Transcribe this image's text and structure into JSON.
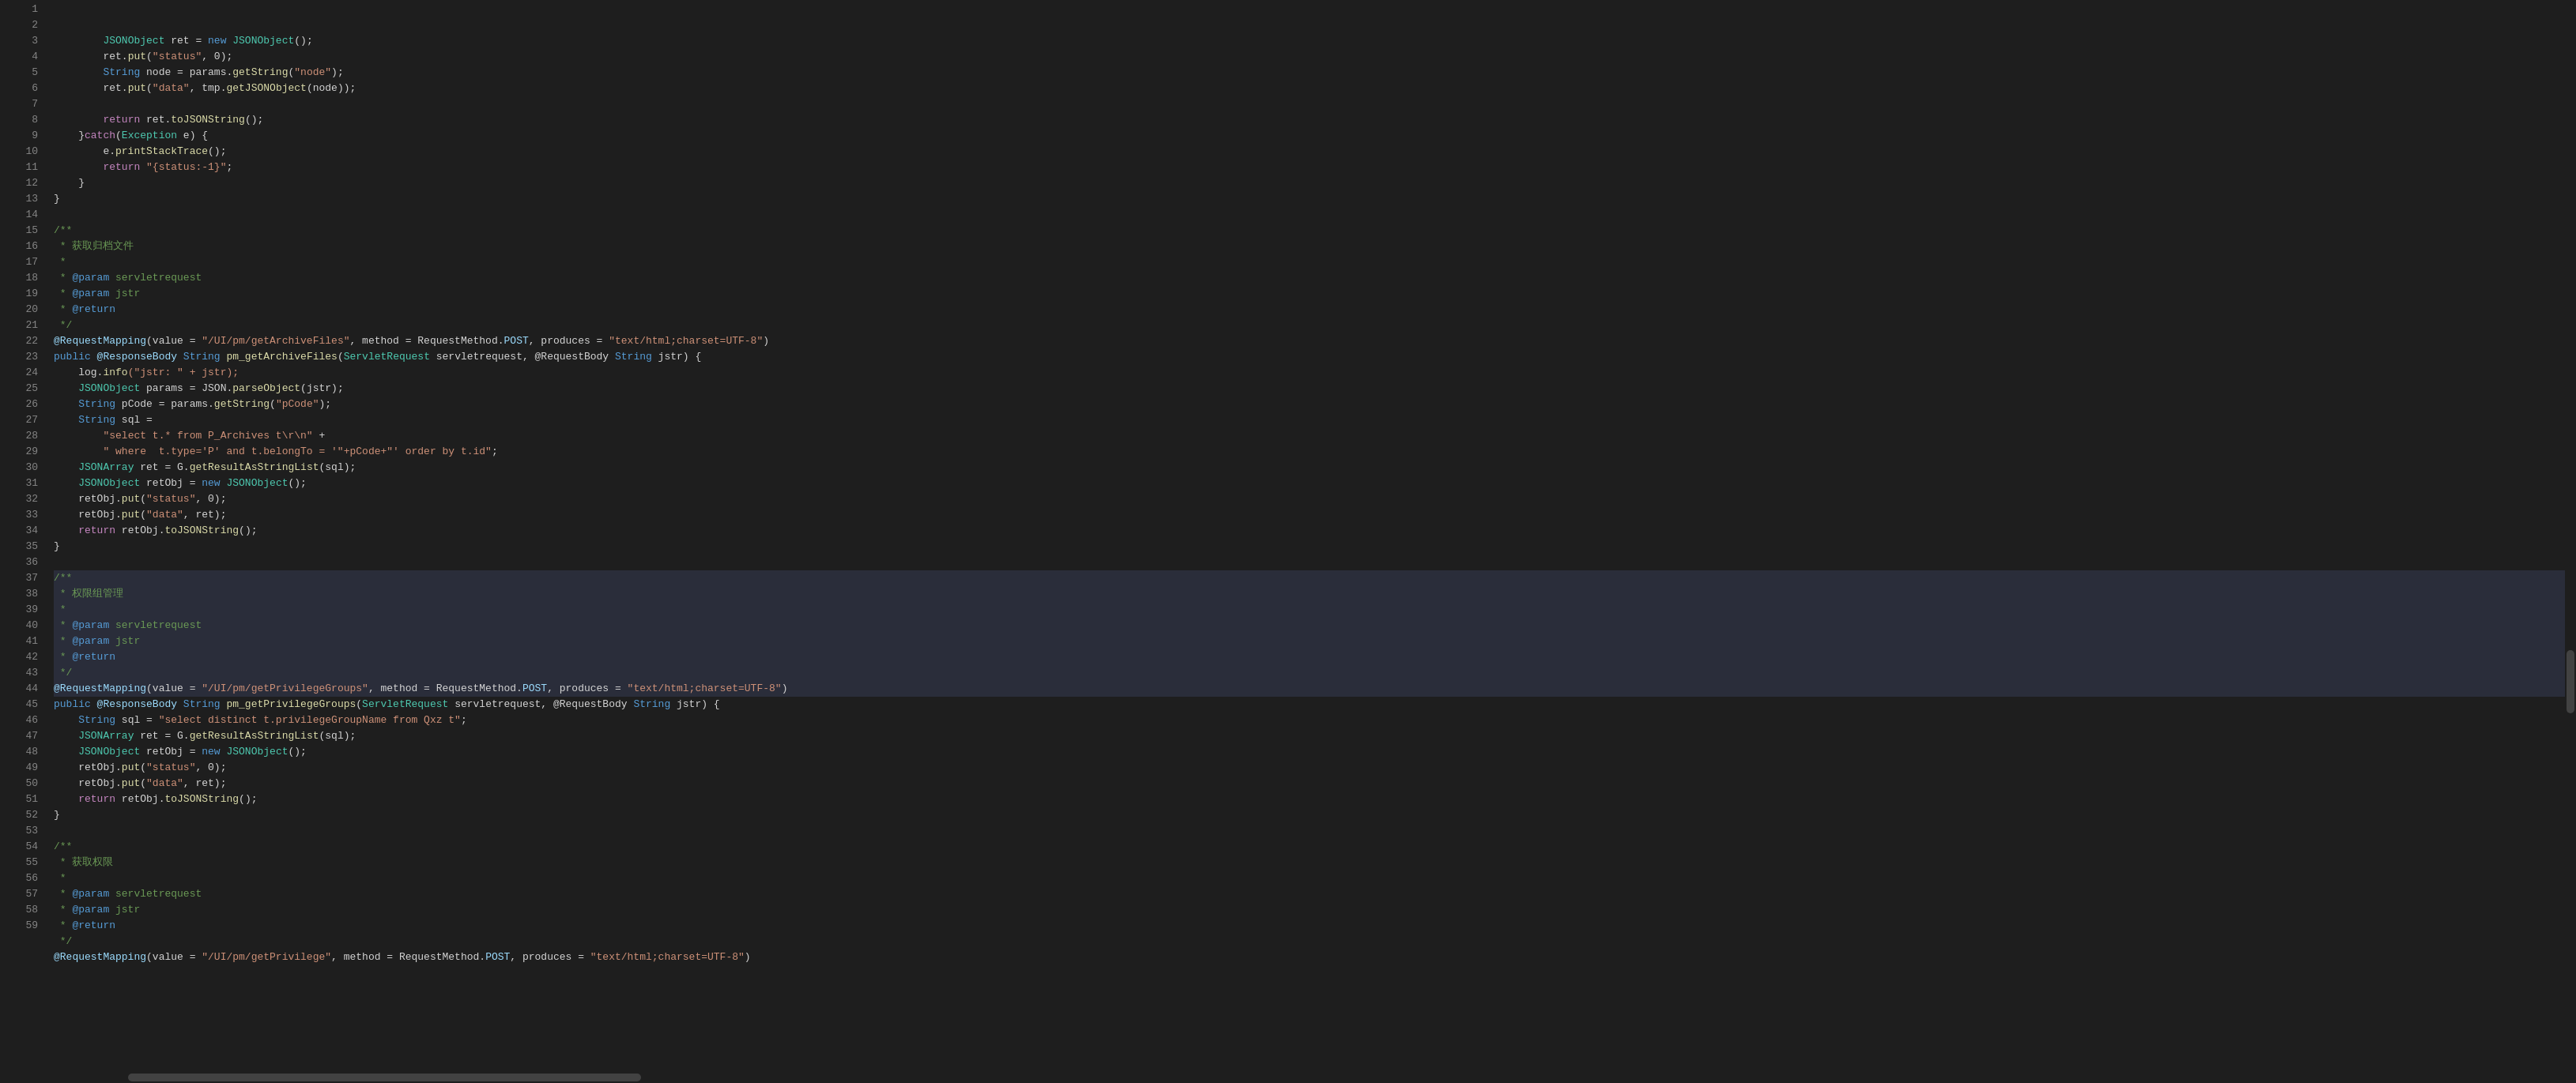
{
  "editor": {
    "background": "#1e1e1e",
    "lineHeight": 20,
    "fontSize": 13
  },
  "lines": [
    {
      "num": 1,
      "tokens": [
        {
          "t": "        ",
          "c": ""
        },
        {
          "t": "JSONObject",
          "c": "class-name"
        },
        {
          "t": " ret = ",
          "c": "punc"
        },
        {
          "t": "new",
          "c": "kw"
        },
        {
          "t": " ",
          "c": ""
        },
        {
          "t": "JSONObject",
          "c": "class-name"
        },
        {
          "t": "();",
          "c": "punc"
        }
      ]
    },
    {
      "num": 2,
      "tokens": [
        {
          "t": "        ret.",
          "c": "punc"
        },
        {
          "t": "put",
          "c": "method"
        },
        {
          "t": "(",
          "c": "punc"
        },
        {
          "t": "\"status\"",
          "c": "str"
        },
        {
          "t": ", 0);",
          "c": "punc"
        }
      ]
    },
    {
      "num": 3,
      "tokens": [
        {
          "t": "        ",
          "c": ""
        },
        {
          "t": "String",
          "c": "kw"
        },
        {
          "t": " node = params.",
          "c": "punc"
        },
        {
          "t": "getString",
          "c": "method"
        },
        {
          "t": "(",
          "c": "punc"
        },
        {
          "t": "\"node\"",
          "c": "str"
        },
        {
          "t": ");",
          "c": "punc"
        }
      ]
    },
    {
      "num": 4,
      "tokens": [
        {
          "t": "        ret.",
          "c": "punc"
        },
        {
          "t": "put",
          "c": "method"
        },
        {
          "t": "(",
          "c": "punc"
        },
        {
          "t": "\"data\"",
          "c": "str"
        },
        {
          "t": ", tmp.",
          "c": "punc"
        },
        {
          "t": "getJSONObject",
          "c": "method"
        },
        {
          "t": "(node));",
          "c": "punc"
        }
      ]
    },
    {
      "num": 5,
      "tokens": []
    },
    {
      "num": 6,
      "tokens": [
        {
          "t": "        ",
          "c": ""
        },
        {
          "t": "return",
          "c": "kw2"
        },
        {
          "t": " ret.",
          "c": "punc"
        },
        {
          "t": "toJSONString",
          "c": "method"
        },
        {
          "t": "();",
          "c": "punc"
        }
      ]
    },
    {
      "num": 7,
      "tokens": [
        {
          "t": "    }",
          "c": "punc"
        },
        {
          "t": "catch",
          "c": "kw2"
        },
        {
          "t": "(",
          "c": "punc"
        },
        {
          "t": "Exception",
          "c": "class-name"
        },
        {
          "t": " e) {",
          "c": "punc"
        }
      ]
    },
    {
      "num": 8,
      "tokens": [
        {
          "t": "        e.",
          "c": "punc"
        },
        {
          "t": "printStackTrace",
          "c": "method"
        },
        {
          "t": "();",
          "c": "punc"
        }
      ]
    },
    {
      "num": 9,
      "tokens": [
        {
          "t": "        ",
          "c": ""
        },
        {
          "t": "return",
          "c": "kw2"
        },
        {
          "t": " ",
          "c": ""
        },
        {
          "t": "\"{status:-1}\"",
          "c": "str"
        },
        {
          "t": ";",
          "c": "punc"
        }
      ]
    },
    {
      "num": 10,
      "tokens": [
        {
          "t": "    }",
          "c": "punc"
        }
      ]
    },
    {
      "num": 11,
      "tokens": [
        {
          "t": "}",
          "c": "punc"
        }
      ]
    },
    {
      "num": 12,
      "tokens": []
    },
    {
      "num": 13,
      "tokens": [
        {
          "t": "/**",
          "c": "comment"
        }
      ]
    },
    {
      "num": 14,
      "tokens": [
        {
          "t": " * ",
          "c": "comment"
        },
        {
          "t": "获取归档文件",
          "c": "comment"
        }
      ]
    },
    {
      "num": 15,
      "tokens": [
        {
          "t": " *",
          "c": "comment"
        }
      ]
    },
    {
      "num": 16,
      "tokens": [
        {
          "t": " * ",
          "c": "comment"
        },
        {
          "t": "@param",
          "c": "param-tag"
        },
        {
          "t": " servletrequest",
          "c": "comment"
        }
      ]
    },
    {
      "num": 17,
      "tokens": [
        {
          "t": " * ",
          "c": "comment"
        },
        {
          "t": "@param",
          "c": "param-tag"
        },
        {
          "t": " jstr",
          "c": "comment"
        }
      ]
    },
    {
      "num": 18,
      "tokens": [
        {
          "t": " * ",
          "c": "comment"
        },
        {
          "t": "@return",
          "c": "param-tag"
        }
      ]
    },
    {
      "num": 19,
      "tokens": [
        {
          "t": " */",
          "c": "comment"
        }
      ]
    },
    {
      "num": 20,
      "tokens": [
        {
          "t": "@RequestMapping",
          "c": "annotation"
        },
        {
          "t": "(value = ",
          "c": "punc"
        },
        {
          "t": "\"/UI/pm/getArchiveFiles\"",
          "c": "str"
        },
        {
          "t": ", method = RequestMethod.",
          "c": "punc"
        },
        {
          "t": "POST",
          "c": "field"
        },
        {
          "t": ", produces = ",
          "c": "punc"
        },
        {
          "t": "\"text/html;charset=UTF-8\"",
          "c": "str"
        },
        {
          "t": ")",
          "c": "punc"
        }
      ]
    },
    {
      "num": 21,
      "tokens": [
        {
          "t": "public",
          "c": "kw"
        },
        {
          "t": " @ResponseBody ",
          "c": "annotation"
        },
        {
          "t": "String",
          "c": "kw"
        },
        {
          "t": " ",
          "c": ""
        },
        {
          "t": "pm_getArchiveFiles",
          "c": "method"
        },
        {
          "t": "(",
          "c": "punc"
        },
        {
          "t": "ServletRequest",
          "c": "class-name"
        },
        {
          "t": " servletrequest, @RequestBody ",
          "c": "punc"
        },
        {
          "t": "String",
          "c": "kw"
        },
        {
          "t": " jstr) {",
          "c": "punc"
        }
      ]
    },
    {
      "num": 22,
      "tokens": [
        {
          "t": "    log.",
          "c": "punc"
        },
        {
          "t": "info",
          "c": "method"
        },
        {
          "t": "(\"jstr: \" + jstr);",
          "c": "str"
        }
      ]
    },
    {
      "num": 23,
      "tokens": [
        {
          "t": "    ",
          "c": ""
        },
        {
          "t": "JSONObject",
          "c": "class-name"
        },
        {
          "t": " params = JSON.",
          "c": "punc"
        },
        {
          "t": "parseObject",
          "c": "method"
        },
        {
          "t": "(jstr);",
          "c": "punc"
        }
      ]
    },
    {
      "num": 24,
      "tokens": [
        {
          "t": "    ",
          "c": ""
        },
        {
          "t": "String",
          "c": "kw"
        },
        {
          "t": " pCode = params.",
          "c": "punc"
        },
        {
          "t": "getString",
          "c": "method"
        },
        {
          "t": "(",
          "c": "punc"
        },
        {
          "t": "\"pCode\"",
          "c": "str"
        },
        {
          "t": ");",
          "c": "punc"
        }
      ]
    },
    {
      "num": 25,
      "tokens": [
        {
          "t": "    ",
          "c": ""
        },
        {
          "t": "String",
          "c": "kw"
        },
        {
          "t": " sql =",
          "c": "punc"
        }
      ]
    },
    {
      "num": 26,
      "tokens": [
        {
          "t": "        ",
          "c": ""
        },
        {
          "t": "\"select t.* from P_Archives t\\r\\n\"",
          "c": "str"
        },
        {
          "t": " +",
          "c": "punc"
        }
      ]
    },
    {
      "num": 27,
      "tokens": [
        {
          "t": "        ",
          "c": ""
        },
        {
          "t": "\" where  t.type='P' and t.belongTo = '\"+pCode+\"' order by t.id\"",
          "c": "str"
        },
        {
          "t": ";",
          "c": "punc"
        }
      ]
    },
    {
      "num": 28,
      "tokens": [
        {
          "t": "    ",
          "c": ""
        },
        {
          "t": "JSONArray",
          "c": "class-name"
        },
        {
          "t": " ret = G.",
          "c": "punc"
        },
        {
          "t": "getResultAsStringList",
          "c": "method"
        },
        {
          "t": "(sql);",
          "c": "punc"
        }
      ]
    },
    {
      "num": 29,
      "tokens": [
        {
          "t": "    ",
          "c": ""
        },
        {
          "t": "JSONObject",
          "c": "class-name"
        },
        {
          "t": " retObj = ",
          "c": "punc"
        },
        {
          "t": "new",
          "c": "kw"
        },
        {
          "t": " ",
          "c": ""
        },
        {
          "t": "JSONObject",
          "c": "class-name"
        },
        {
          "t": "();",
          "c": "punc"
        }
      ]
    },
    {
      "num": 30,
      "tokens": [
        {
          "t": "    retObj.",
          "c": "punc"
        },
        {
          "t": "put",
          "c": "method"
        },
        {
          "t": "(",
          "c": "punc"
        },
        {
          "t": "\"status\"",
          "c": "str"
        },
        {
          "t": ", 0);",
          "c": "punc"
        }
      ]
    },
    {
      "num": 31,
      "tokens": [
        {
          "t": "    retObj.",
          "c": "punc"
        },
        {
          "t": "put",
          "c": "method"
        },
        {
          "t": "(",
          "c": "punc"
        },
        {
          "t": "\"data\"",
          "c": "str"
        },
        {
          "t": ", ret);",
          "c": "punc"
        }
      ]
    },
    {
      "num": 32,
      "tokens": [
        {
          "t": "    ",
          "c": ""
        },
        {
          "t": "return",
          "c": "kw2"
        },
        {
          "t": " retObj.",
          "c": "punc"
        },
        {
          "t": "toJSONString",
          "c": "method"
        },
        {
          "t": "();",
          "c": "punc"
        }
      ]
    },
    {
      "num": 33,
      "tokens": [
        {
          "t": "}",
          "c": "punc"
        }
      ]
    },
    {
      "num": 34,
      "tokens": []
    },
    {
      "num": 35,
      "tokens": [
        {
          "t": "/**",
          "c": "comment"
        }
      ]
    },
    {
      "num": 36,
      "tokens": [
        {
          "t": " * ",
          "c": "comment"
        },
        {
          "t": "权限组管理",
          "c": "comment"
        }
      ]
    },
    {
      "num": 37,
      "tokens": [
        {
          "t": " *",
          "c": "comment"
        }
      ]
    },
    {
      "num": 38,
      "tokens": [
        {
          "t": " * ",
          "c": "comment"
        },
        {
          "t": "@param",
          "c": "param-tag"
        },
        {
          "t": " servletrequest",
          "c": "comment"
        }
      ]
    },
    {
      "num": 39,
      "tokens": [
        {
          "t": " * ",
          "c": "comment"
        },
        {
          "t": "@param",
          "c": "param-tag"
        },
        {
          "t": " jstr",
          "c": "comment"
        }
      ]
    },
    {
      "num": 40,
      "tokens": [
        {
          "t": " * ",
          "c": "comment"
        },
        {
          "t": "@return",
          "c": "param-tag"
        }
      ]
    },
    {
      "num": 41,
      "tokens": [
        {
          "t": " */",
          "c": "comment"
        }
      ]
    },
    {
      "num": 42,
      "tokens": [
        {
          "t": "@RequestMapping",
          "c": "annotation"
        },
        {
          "t": "(value = ",
          "c": "punc"
        },
        {
          "t": "\"/UI/pm/getPrivilegeGroups\"",
          "c": "str"
        },
        {
          "t": ", method = RequestMethod.",
          "c": "punc"
        },
        {
          "t": "POST",
          "c": "field"
        },
        {
          "t": ", produces = ",
          "c": "punc"
        },
        {
          "t": "\"text/html;charset=UTF-8\"",
          "c": "str"
        },
        {
          "t": ")",
          "c": "punc"
        }
      ]
    },
    {
      "num": 43,
      "tokens": [
        {
          "t": "public",
          "c": "kw"
        },
        {
          "t": " @ResponseBody ",
          "c": "annotation"
        },
        {
          "t": "String",
          "c": "kw"
        },
        {
          "t": " ",
          "c": ""
        },
        {
          "t": "pm_getPrivilegeGroups",
          "c": "method"
        },
        {
          "t": "(",
          "c": "punc"
        },
        {
          "t": "ServletRequest",
          "c": "class-name"
        },
        {
          "t": " servletrequest, @RequestBody ",
          "c": "punc"
        },
        {
          "t": "String",
          "c": "kw"
        },
        {
          "t": " jstr) {",
          "c": "punc"
        }
      ]
    },
    {
      "num": 44,
      "tokens": [
        {
          "t": "    ",
          "c": ""
        },
        {
          "t": "String",
          "c": "kw"
        },
        {
          "t": " sql = ",
          "c": "punc"
        },
        {
          "t": "\"select distinct t.privilegeGroupName from Qxz t\"",
          "c": "str"
        },
        {
          "t": ";",
          "c": "punc"
        }
      ]
    },
    {
      "num": 45,
      "tokens": [
        {
          "t": "    ",
          "c": ""
        },
        {
          "t": "JSONArray",
          "c": "class-name"
        },
        {
          "t": " ret = G.",
          "c": "punc"
        },
        {
          "t": "getResultAsStringList",
          "c": "method"
        },
        {
          "t": "(sql);",
          "c": "punc"
        }
      ]
    },
    {
      "num": 46,
      "tokens": [
        {
          "t": "    ",
          "c": ""
        },
        {
          "t": "JSONObject",
          "c": "class-name"
        },
        {
          "t": " retObj = ",
          "c": "punc"
        },
        {
          "t": "new",
          "c": "kw"
        },
        {
          "t": " ",
          "c": ""
        },
        {
          "t": "JSONObject",
          "c": "class-name"
        },
        {
          "t": "();",
          "c": "punc"
        }
      ]
    },
    {
      "num": 47,
      "tokens": [
        {
          "t": "    retObj.",
          "c": "punc"
        },
        {
          "t": "put",
          "c": "method"
        },
        {
          "t": "(",
          "c": "punc"
        },
        {
          "t": "\"status\"",
          "c": "str"
        },
        {
          "t": ", 0);",
          "c": "punc"
        }
      ]
    },
    {
      "num": 48,
      "tokens": [
        {
          "t": "    retObj.",
          "c": "punc"
        },
        {
          "t": "put",
          "c": "method"
        },
        {
          "t": "(",
          "c": "punc"
        },
        {
          "t": "\"data\"",
          "c": "str"
        },
        {
          "t": ", ret);",
          "c": "punc"
        }
      ]
    },
    {
      "num": 49,
      "tokens": [
        {
          "t": "    ",
          "c": ""
        },
        {
          "t": "return",
          "c": "kw2"
        },
        {
          "t": " retObj.",
          "c": "punc"
        },
        {
          "t": "toJSONString",
          "c": "method"
        },
        {
          "t": "();",
          "c": "punc"
        }
      ]
    },
    {
      "num": 50,
      "tokens": [
        {
          "t": "}",
          "c": "punc"
        }
      ]
    },
    {
      "num": 51,
      "tokens": []
    },
    {
      "num": 52,
      "tokens": [
        {
          "t": "/**",
          "c": "comment"
        }
      ]
    },
    {
      "num": 53,
      "tokens": [
        {
          "t": " * ",
          "c": "comment"
        },
        {
          "t": "获取权限",
          "c": "comment"
        }
      ]
    },
    {
      "num": 54,
      "tokens": [
        {
          "t": " *",
          "c": "comment"
        }
      ]
    },
    {
      "num": 55,
      "tokens": [
        {
          "t": " * ",
          "c": "comment"
        },
        {
          "t": "@param",
          "c": "param-tag"
        },
        {
          "t": " servletrequest",
          "c": "comment"
        }
      ]
    },
    {
      "num": 56,
      "tokens": [
        {
          "t": " * ",
          "c": "comment"
        },
        {
          "t": "@param",
          "c": "param-tag"
        },
        {
          "t": " jstr",
          "c": "comment"
        }
      ]
    },
    {
      "num": 57,
      "tokens": [
        {
          "t": " * ",
          "c": "comment"
        },
        {
          "t": "@return",
          "c": "param-tag"
        }
      ]
    },
    {
      "num": 58,
      "tokens": [
        {
          "t": " */",
          "c": "comment"
        }
      ]
    },
    {
      "num": 59,
      "tokens": [
        {
          "t": "@RequestMapping",
          "c": "annotation"
        },
        {
          "t": "(value = ",
          "c": "punc"
        },
        {
          "t": "\"/UI/pm/getPrivilege\"",
          "c": "str"
        },
        {
          "t": ", method = RequestMethod.",
          "c": "punc"
        },
        {
          "t": "POST",
          "c": "field"
        },
        {
          "t": ", produces = ",
          "c": "punc"
        },
        {
          "t": "\"text/html;charset=UTF-8\"",
          "c": "str"
        },
        {
          "t": ")",
          "c": "punc"
        }
      ]
    }
  ],
  "highlighted_lines": [
    35,
    36,
    37,
    38,
    39,
    40,
    41,
    42
  ],
  "scrollbar": {
    "vertical_thumb_top_percent": 60
  }
}
